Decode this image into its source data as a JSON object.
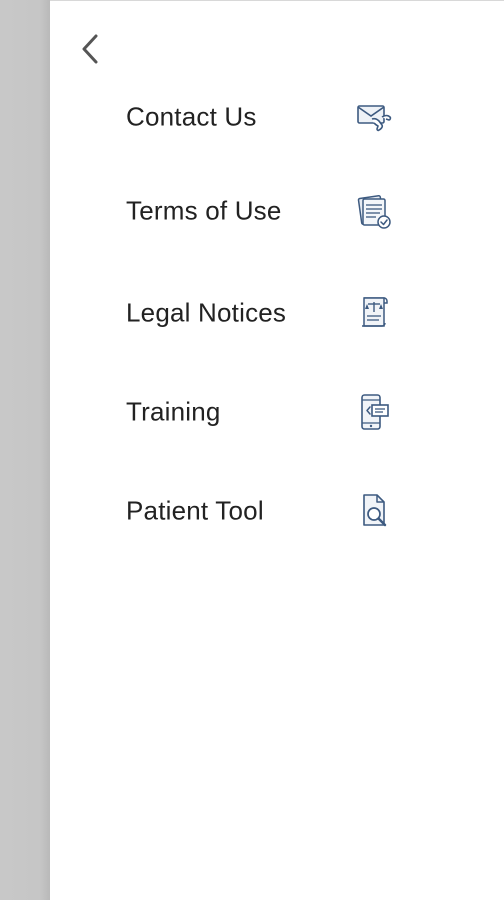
{
  "navigation": {
    "back_icon": "chevron-left-icon"
  },
  "menu": {
    "items": [
      {
        "label": "Contact Us",
        "icon": "envelope-phone-icon"
      },
      {
        "label": "Terms of Use",
        "icon": "documents-check-icon"
      },
      {
        "label": "Legal Notices",
        "icon": "scroll-scales-icon"
      },
      {
        "label": "Training",
        "icon": "mobile-presentation-icon"
      },
      {
        "label": "Patient Tool",
        "icon": "document-search-icon"
      }
    ]
  },
  "colors": {
    "icon_stroke": "#3d5a80",
    "icon_fill_light": "#e6ebf2",
    "text": "#222222",
    "scrim": "#c6c6c6"
  }
}
